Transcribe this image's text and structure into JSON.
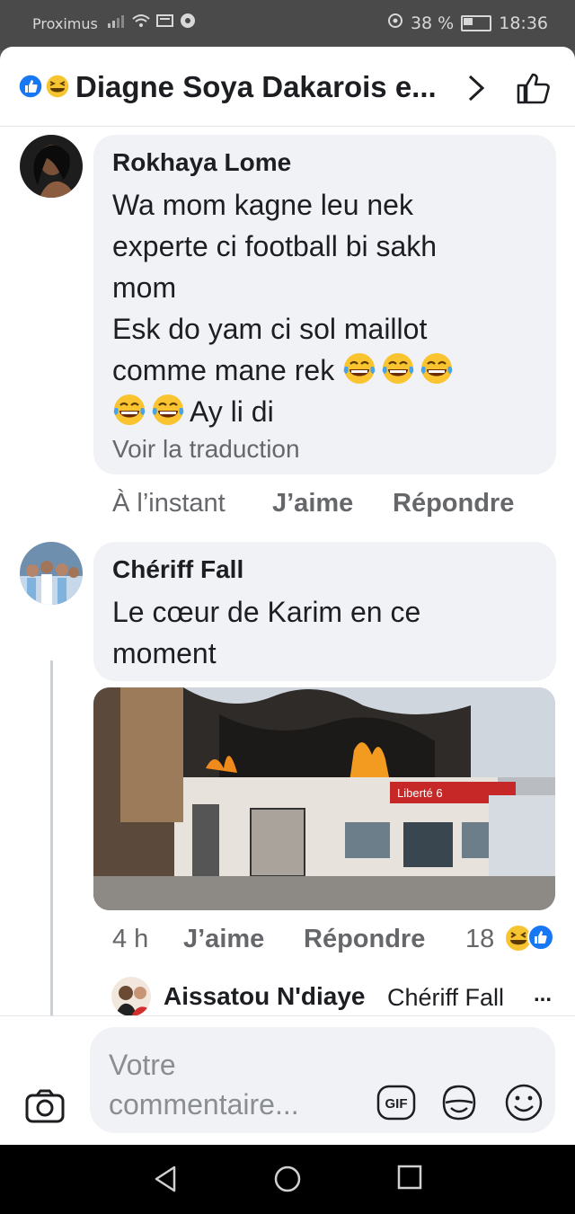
{
  "status_bar": {
    "carrier": "Proximus",
    "battery_percent": "38 %",
    "time": "18:36"
  },
  "header": {
    "title": "Diagne Soya Dakarois e...",
    "icons": [
      "like-reaction-icon",
      "laugh-reaction-icon",
      "chevron-right-icon",
      "thumbs-up-icon"
    ]
  },
  "comments": [
    {
      "author": "Rokhaya Lome",
      "lines": [
        "Wa mom kagne leu nek",
        "experte ci football bi sakh",
        "mom",
        "Esk do yam ci sol maillot",
        "comme mane rek"
      ],
      "last_line_text": "Ay li di",
      "emoji_name": "tears-of-joy-emoji",
      "translate": "Voir la traduction",
      "time": "À l’instant",
      "like": "J’aime",
      "reply": "Répondre"
    },
    {
      "author": "Chériff Fall",
      "lines": [
        "Le cœur de Karim en ce",
        "moment"
      ],
      "image": "burning-liberte6-building-photo",
      "image_sign": "Liberté 6",
      "time": "4 h",
      "like": "J’aime",
      "reply": "Répondre",
      "reaction_count": "18"
    }
  ],
  "reply_preview": {
    "author": "Aissatou N'diaye",
    "text": "Chériff Fall",
    "more": "..."
  },
  "composer": {
    "placeholder_line1": "Votre",
    "placeholder_line2": "commentaire...",
    "gif_label": "GIF"
  },
  "colors": {
    "facebook_blue": "#1877f2",
    "bubble_gray": "#f0f2f5",
    "meta_gray": "#65676b"
  }
}
